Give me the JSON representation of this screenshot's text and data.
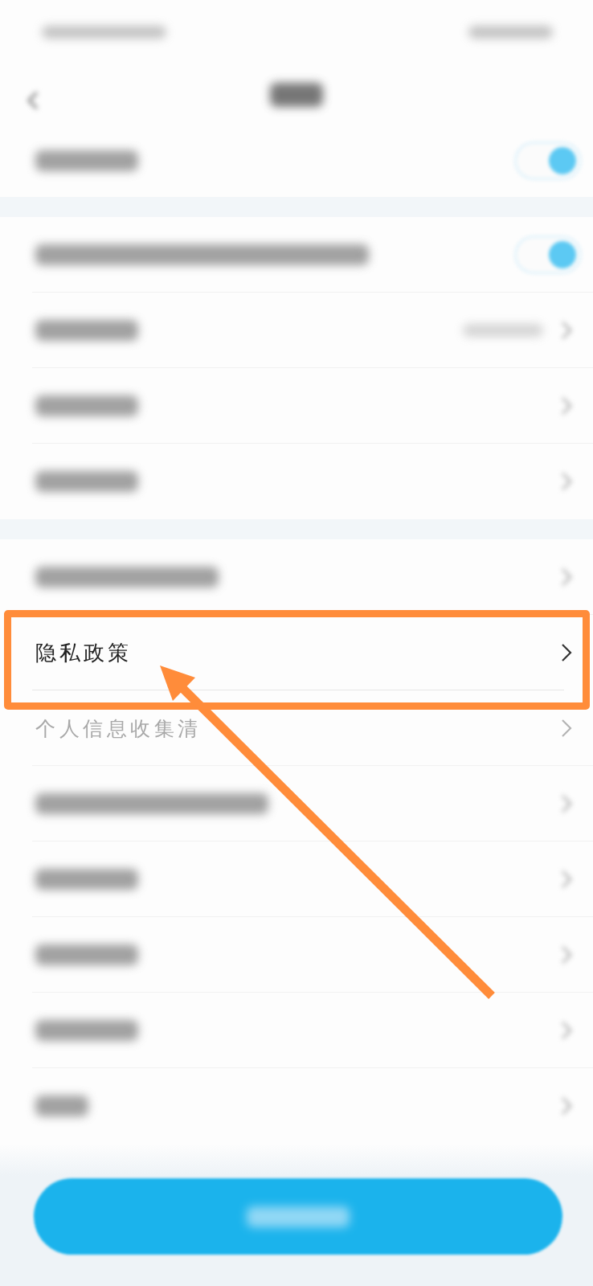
{
  "status_bar": {
    "blurred": true
  },
  "header": {
    "back_button": true,
    "title_blurred": true
  },
  "sections": [
    {
      "rows": [
        {
          "kind": "toggle",
          "blurred": true,
          "on": true,
          "highlighted": false
        }
      ]
    },
    {
      "rows": [
        {
          "kind": "toggle",
          "blurred": true,
          "on": true,
          "highlighted": false
        },
        {
          "kind": "value",
          "blurred": true,
          "value_blurred": true,
          "highlighted": false
        },
        {
          "kind": "chevron",
          "blurred": true,
          "highlighted": false
        },
        {
          "kind": "chevron",
          "blurred": true,
          "highlighted": false
        }
      ]
    },
    {
      "rows": [
        {
          "kind": "chevron",
          "blurred": true,
          "highlighted": false
        },
        {
          "kind": "chevron",
          "blurred": false,
          "label": "隐私政策",
          "faded": false,
          "highlighted": true
        },
        {
          "kind": "chevron",
          "blurred": false,
          "label": "个人信息收集清",
          "faded": true,
          "highlighted": false
        },
        {
          "kind": "chevron",
          "blurred": true,
          "highlighted": false
        },
        {
          "kind": "chevron",
          "blurred": true,
          "highlighted": false
        },
        {
          "kind": "chevron",
          "blurred": true,
          "highlighted": false
        },
        {
          "kind": "chevron",
          "blurred": true,
          "highlighted": false
        },
        {
          "kind": "chevron",
          "blurred": true,
          "highlighted": false
        }
      ]
    }
  ],
  "bottom_button": {
    "label_blurred": true
  }
}
